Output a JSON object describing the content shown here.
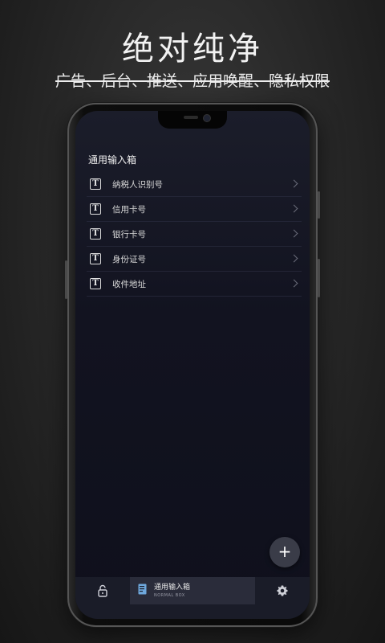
{
  "promo": {
    "headline": "绝对纯净",
    "subline": "广告、后台、推送、应用唤醒、隐私权限"
  },
  "app": {
    "section_title": "通用输入箱",
    "items": [
      {
        "label": "纳税人识别号",
        "icon": "text-box-icon"
      },
      {
        "label": "信用卡号",
        "icon": "text-box-icon"
      },
      {
        "label": "银行卡号",
        "icon": "text-box-icon"
      },
      {
        "label": "身份证号",
        "icon": "text-box-icon"
      },
      {
        "label": "收件地址",
        "icon": "text-box-icon"
      }
    ],
    "fab_symbol": "+",
    "tabbar": {
      "left_icon": "lock-icon",
      "center_label": "通用输入箱",
      "center_sublabel": "NORMAL BOX",
      "right_icon": "gear-icon"
    }
  },
  "colors": {
    "screen_bg": "#121320",
    "tabbar_bg": "#1a1c28",
    "tab_active_bg": "#2a2c3a",
    "fab_bg": "#3a3c48",
    "tab_icon_blue": "#6fa8dc"
  }
}
